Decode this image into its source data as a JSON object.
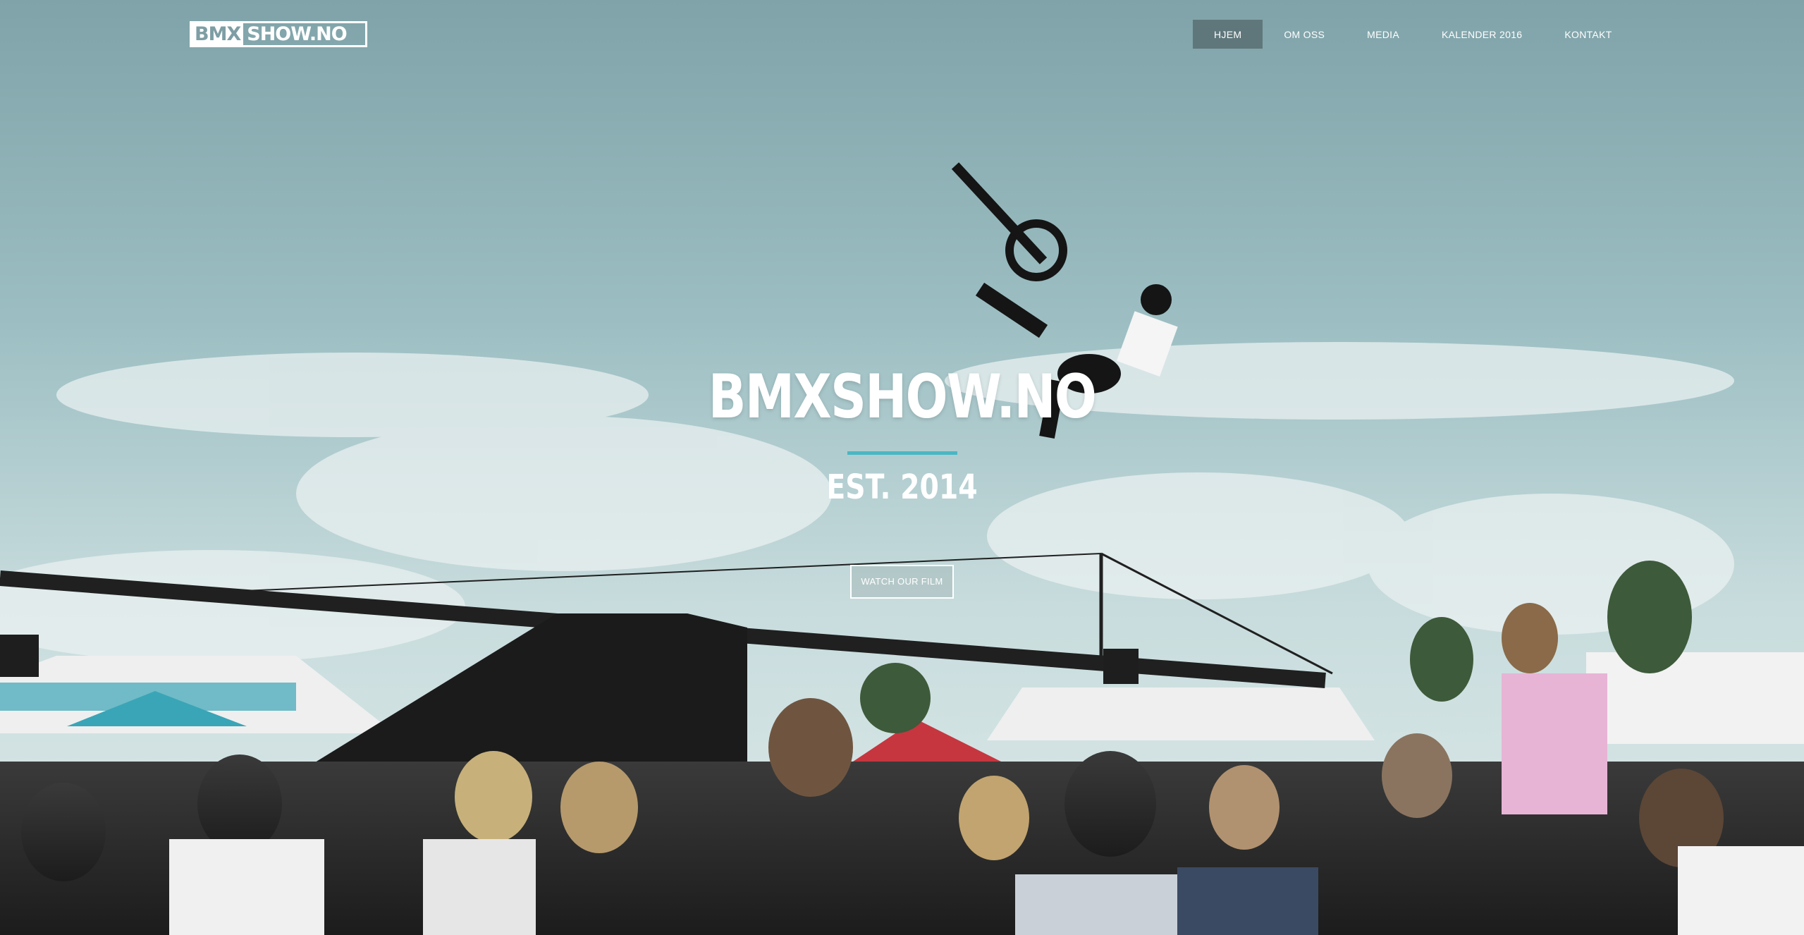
{
  "logo": {
    "box_text": "BMX",
    "text": "SHOW.NO"
  },
  "nav": {
    "items": [
      {
        "label": "HJEM",
        "active": true
      },
      {
        "label": "OM OSS",
        "active": false
      },
      {
        "label": "MEDIA",
        "active": false
      },
      {
        "label": "KALENDER 2016",
        "active": false
      },
      {
        "label": "KONTAKT",
        "active": false
      }
    ]
  },
  "hero": {
    "title": "BMXSHOW.NO",
    "subtitle": "EST. 2014",
    "button_label": "WATCH OUR FILM"
  },
  "colors": {
    "accent": "#4ab7c4",
    "nav_active_bg": "#5f777b",
    "sky_top": "#7fa8ad",
    "sky_bottom": "#d4e3e4"
  }
}
